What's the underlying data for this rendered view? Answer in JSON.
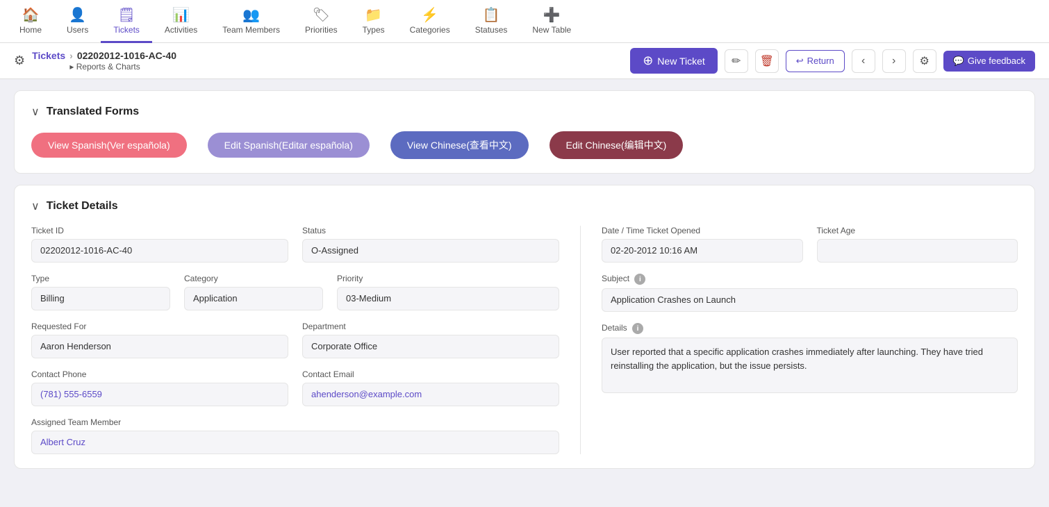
{
  "nav": {
    "items": [
      {
        "id": "home",
        "label": "Home",
        "icon": "🏠",
        "active": false
      },
      {
        "id": "users",
        "label": "Users",
        "icon": "👤",
        "active": false
      },
      {
        "id": "tickets",
        "label": "Tickets",
        "icon": "🗒",
        "active": true
      },
      {
        "id": "activities",
        "label": "Activities",
        "icon": "📊",
        "active": false
      },
      {
        "id": "team-members",
        "label": "Team Members",
        "icon": "👥",
        "active": false
      },
      {
        "id": "priorities",
        "label": "Priorities",
        "icon": "🏷",
        "active": false
      },
      {
        "id": "types",
        "label": "Types",
        "icon": "📁",
        "active": false
      },
      {
        "id": "categories",
        "label": "Categories",
        "icon": "⚡",
        "active": false
      },
      {
        "id": "statuses",
        "label": "Statuses",
        "icon": "📋",
        "active": false
      },
      {
        "id": "new-table",
        "label": "New Table",
        "icon": "➕",
        "active": false
      }
    ]
  },
  "toolbar": {
    "breadcrumb_parent": "Tickets",
    "breadcrumb_current": "02202012-1016-AC-40",
    "reports_link": "Reports & Charts",
    "new_ticket_label": "New Ticket",
    "return_label": "Return",
    "feedback_label": "Give feedback"
  },
  "translated_forms": {
    "section_title": "Translated Forms",
    "btn_view_spanish": "View Spanish(Ver española)",
    "btn_edit_spanish": "Edit Spanish(Editar española)",
    "btn_view_chinese": "View Chinese(查看中文)",
    "btn_edit_chinese": "Edit Chinese(编辑中文)"
  },
  "ticket_details": {
    "section_title": "Ticket Details",
    "ticket_id_label": "Ticket ID",
    "ticket_id_value": "02202012-1016-AC-40",
    "status_label": "Status",
    "status_value": "O-Assigned",
    "date_label": "Date / Time Ticket Opened",
    "date_value": "02-20-2012 10:16 AM",
    "ticket_age_label": "Ticket Age",
    "ticket_age_value": "",
    "type_label": "Type",
    "type_value": "Billing",
    "category_label": "Category",
    "category_value": "Application",
    "priority_label": "Priority",
    "priority_value": "03-Medium",
    "subject_label": "Subject",
    "subject_value": "Application Crashes on Launch",
    "details_label": "Details",
    "details_value": "User reported that a specific application crashes immediately after launching. They have tried reinstalling the application, but the issue persists.",
    "requested_for_label": "Requested For",
    "requested_for_value": "Aaron Henderson",
    "department_label": "Department",
    "department_value": "Corporate Office",
    "contact_phone_label": "Contact Phone",
    "contact_phone_value": "(781) 555-6559",
    "contact_email_label": "Contact Email",
    "contact_email_value": "ahenderson@example.com",
    "assigned_team_label": "Assigned Team Member",
    "assigned_team_value": "Albert Cruz"
  }
}
